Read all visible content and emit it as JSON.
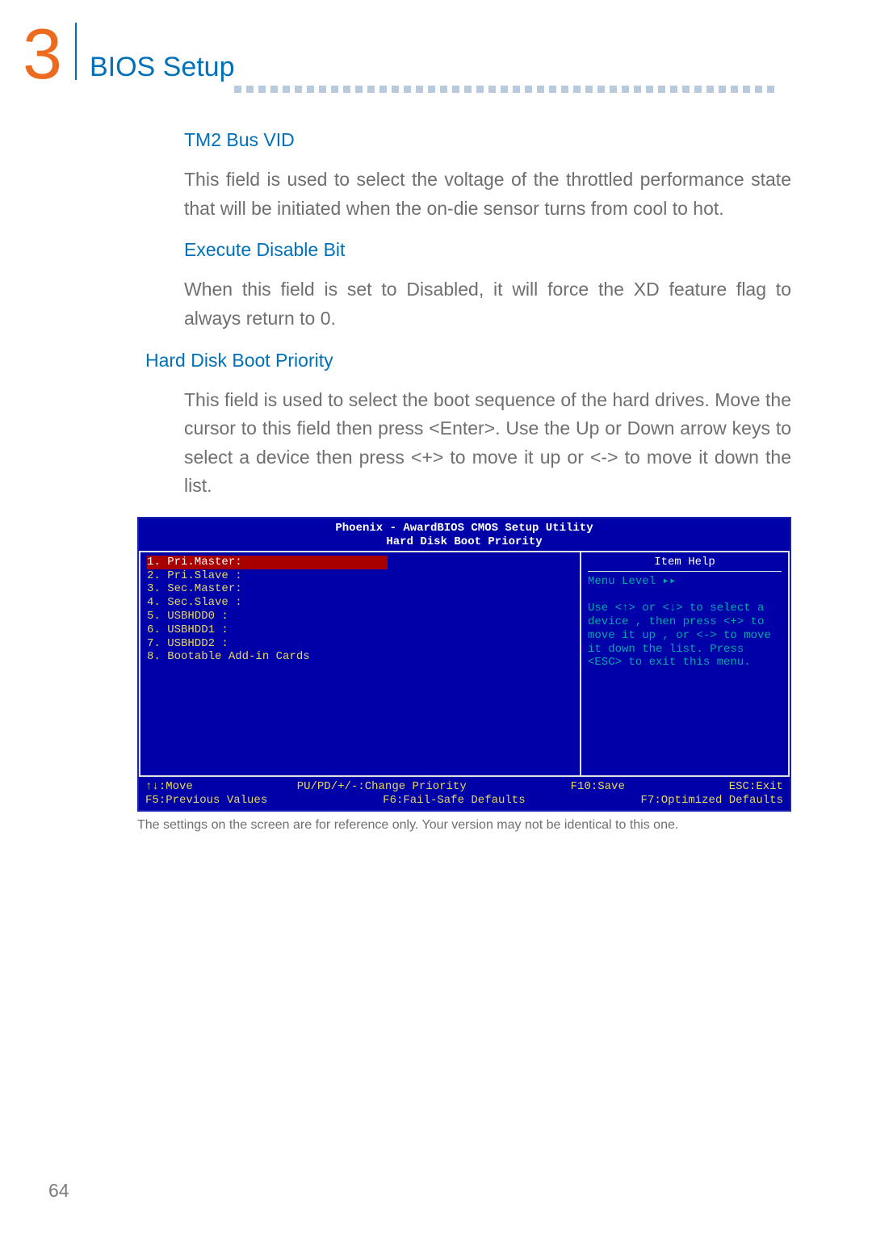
{
  "chapter": {
    "number": "3",
    "title": "BIOS Setup"
  },
  "headings": {
    "tm2": "TM2 Bus VID",
    "edb": "Execute Disable Bit",
    "hdbp": "Hard Disk Boot Priority"
  },
  "paragraphs": {
    "tm2": "This field is used to select the voltage of the throttled performance state that will be initiated when the on-die sensor turns from cool to hot.",
    "edb": "When this field is set to Disabled, it will force the XD feature flag to always return to 0.",
    "hdbp": "This field is used to select the boot sequence of the hard drives. Move the cursor to this field then press <Enter>. Use the Up or Down arrow keys to select a device then press <+> to move it up or <-> to move it down the list."
  },
  "bios": {
    "title_line1": "Phoenix - AwardBIOS CMOS Setup Utility",
    "title_line2": "Hard Disk Boot Priority",
    "items": [
      "1. Pri.Master:",
      "2. Pri.Slave :",
      "3. Sec.Master:",
      "4. Sec.Slave :",
      "5. USBHDD0   :",
      "6. USBHDD1   :",
      "7. USBHDD2   :",
      "8. Bootable Add-in Cards"
    ],
    "help_title": "Item Help",
    "menu_level": "Menu Level   ▸▸",
    "help_text": "Use <↑> or <↓> to select a device , then press <+> to move it up , or <-> to move it down the list. Press <ESC> to exit this menu.",
    "footer": {
      "row1": {
        "c1": "↑↓:Move",
        "c2": "PU/PD/+/-:Change Priority",
        "c3": "F10:Save",
        "c4": "ESC:Exit"
      },
      "row2": {
        "c1": "F5:Previous Values",
        "c2": "F6:Fail-Safe Defaults",
        "c3": "F7:Optimized Defaults"
      }
    }
  },
  "caption": "The settings on the screen are for reference only. Your version may not be identical to this one.",
  "page_number": "64"
}
